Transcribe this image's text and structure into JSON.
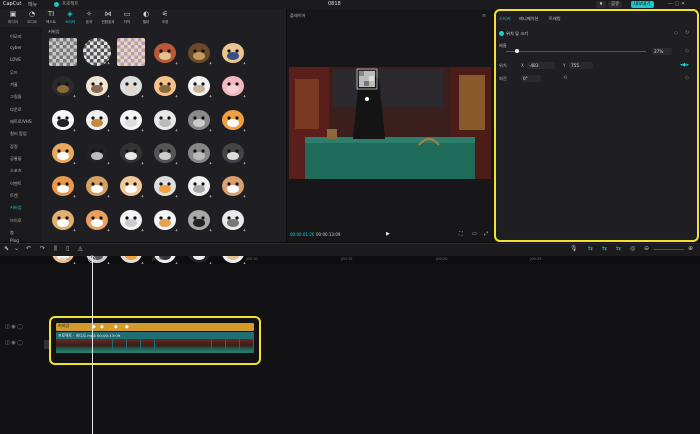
{
  "titlebar": {
    "logo": "CapCut",
    "menu": "메뉴",
    "project": "프로젝트",
    "center_title": "0818",
    "btn_share": "공유",
    "btn_export": "내보내기"
  },
  "toolbar": {
    "tools": [
      {
        "label": "미디어",
        "icon": "media-icon"
      },
      {
        "label": "오디오",
        "icon": "audio-icon"
      },
      {
        "label": "텍스트",
        "icon": "text-icon"
      },
      {
        "label": "스티커",
        "icon": "sticker-icon",
        "active": true
      },
      {
        "label": "효과",
        "icon": "effects-icon"
      },
      {
        "label": "전환효과",
        "icon": "transition-icon"
      },
      {
        "label": "자막",
        "icon": "caption-icon"
      },
      {
        "label": "필터",
        "icon": "filter-icon"
      },
      {
        "label": "조정",
        "icon": "adjust-icon"
      }
    ]
  },
  "leftnav": {
    "items": [
      {
        "label": "이모지"
      },
      {
        "label": "cyber"
      },
      {
        "label": "LOVE"
      },
      {
        "label": "무드"
      },
      {
        "label": "겨울"
      },
      {
        "label": "그림들"
      },
      {
        "label": "다운로"
      },
      {
        "label": "레트로/VHS"
      },
      {
        "label": "컬러 팝업"
      },
      {
        "label": "감정"
      },
      {
        "label": "공룡들"
      },
      {
        "label": "스포츠"
      },
      {
        "label": "이벤트"
      },
      {
        "label": "트렌"
      },
      {
        "label": "커버업",
        "active": true
      },
      {
        "label": "브이로"
      },
      {
        "label": "봄"
      },
      {
        "label": "Plog"
      }
    ]
  },
  "sticker_grid": {
    "title": "커버업",
    "count": 48
  },
  "player": {
    "title": "플레이어",
    "time_current": "00:00:01:26",
    "time_total": "00:00:13:09"
  },
  "properties": {
    "tabs": [
      {
        "label": "스티커",
        "active": true
      },
      {
        "label": "애니메이션"
      },
      {
        "label": "트래킹"
      }
    ],
    "section_title": "위치 및 크기",
    "scale_label": "배율",
    "scale_value": "27%",
    "position_label": "위치",
    "pos_x_label": "X",
    "pos_x_value": "-483",
    "pos_y_label": "Y",
    "pos_y_value": "755",
    "rotation_label": "회전",
    "rotation_value": "0°",
    "scale_fraction": 0.08
  },
  "timeline": {
    "ruler_labels": [
      "00:00",
      "|00:05",
      "|00:10",
      "|00:15",
      "|00:20",
      "|00:25"
    ],
    "clip_label": "프로젝트 · 비디오.mp4  00:00:13:09",
    "effect_label": "커버업"
  },
  "colors": {
    "accent": "#19d0d0",
    "highlight": "#f2e22b",
    "clip_fx": "#d49a2b",
    "clip_video": "#1e6e74"
  }
}
